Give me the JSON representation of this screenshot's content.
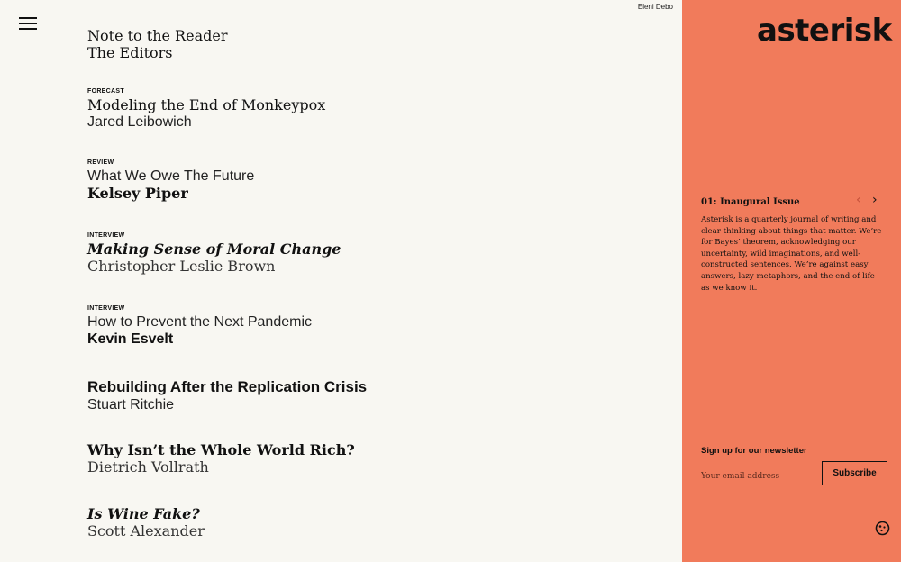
{
  "header": {
    "credit": "Eleni Debo",
    "logo": "asterisk"
  },
  "toc": [
    {
      "kicker": "",
      "title": "Note to the Reader",
      "author": "The Editors"
    },
    {
      "kicker": "FORECAST",
      "title": "Modeling the End of Monkeypox",
      "author": "Jared Leibowich"
    },
    {
      "kicker": "REVIEW",
      "title": "What We Owe The Future",
      "author": "Kelsey Piper"
    },
    {
      "kicker": "INTERVIEW",
      "title": "Making Sense of Moral Change",
      "author": "Christopher Leslie Brown"
    },
    {
      "kicker": "INTERVIEW",
      "title": "How to Prevent the Next Pandemic",
      "author": "Kevin Esvelt"
    },
    {
      "kicker": "",
      "title": "Rebuilding After the Replication Crisis",
      "author": "Stuart Ritchie"
    },
    {
      "kicker": "",
      "title": "Why Isn’t the Whole World Rich?",
      "author": "Dietrich Vollrath"
    },
    {
      "kicker": "",
      "title": "Is Wine Fake?",
      "author": "Scott Alexander"
    }
  ],
  "issue": {
    "title": "01: Inaugural Issue",
    "description": "Asterisk is a quarterly journal of writing and clear thinking about things that matter. We’re for Bayes’ theorem, acknowledging our uncertainty, wild imaginations, and well-constructed sentences. We’re against easy answers, lazy metaphors, and the end of life as we know it.",
    "prev_icon": "chevron-left-icon",
    "next_icon": "chevron-right-icon"
  },
  "newsletter": {
    "label": "Sign up for our newsletter",
    "placeholder": "Your email address",
    "button": "Subscribe"
  },
  "colors": {
    "background": "#f8f7f2",
    "accent": "#f17b5b",
    "text": "#111111"
  }
}
